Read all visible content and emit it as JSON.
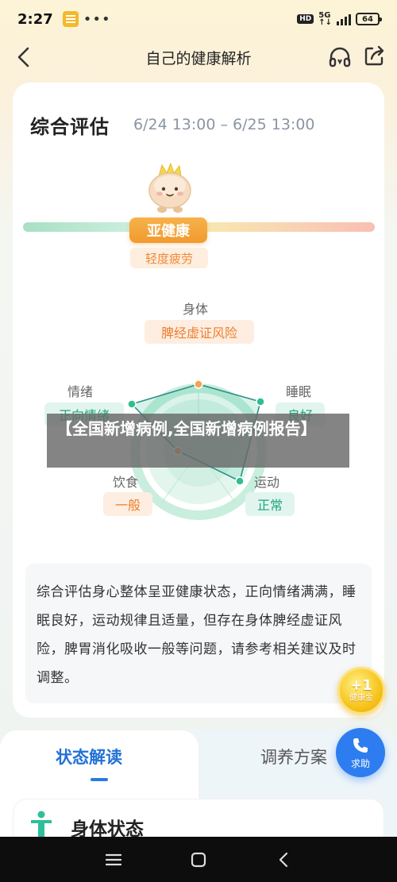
{
  "status_bar": {
    "time": "2:27",
    "dots": "•••",
    "hd": "HD",
    "net_top": "5G",
    "net_bottom": "↑↓",
    "battery": "64"
  },
  "nav": {
    "title": "自己的健康解析"
  },
  "assessment": {
    "title": "综合评估",
    "range": "6/24 13:00 – 6/25 13:00",
    "status": "亚健康",
    "sub_status": "轻度疲劳",
    "dimensions": {
      "body": {
        "label": "身体",
        "value": "脾经虚证风险"
      },
      "sleep": {
        "label": "睡眠",
        "value": "良好"
      },
      "exercise": {
        "label": "运动",
        "value": "正常"
      },
      "diet": {
        "label": "饮食",
        "value": "一般"
      },
      "mood": {
        "label": "情绪",
        "value": "正向情绪"
      }
    },
    "summary": "综合评估身心整体呈亚健康状态，正向情绪满满，睡眠良好，运动规律且适量，但存在身体脾经虚证风险，脾胃消化吸收一般等问题，请参考相关建议及时调整。"
  },
  "bonus": {
    "plus": "+1",
    "label": "健康金"
  },
  "tabs": {
    "status": "状态解读",
    "plan": "调养方案"
  },
  "help": {
    "label": "求助"
  },
  "body_section": {
    "title": "身体状态"
  },
  "overlay": {
    "text": "【全国新增病例,全国新增病例报告】"
  },
  "colors": {
    "accent_blue": "#2a7be0",
    "status_orange": "#f19a2e",
    "tag_green": "#1ea57e",
    "radar_green": "#2fbf8f"
  }
}
